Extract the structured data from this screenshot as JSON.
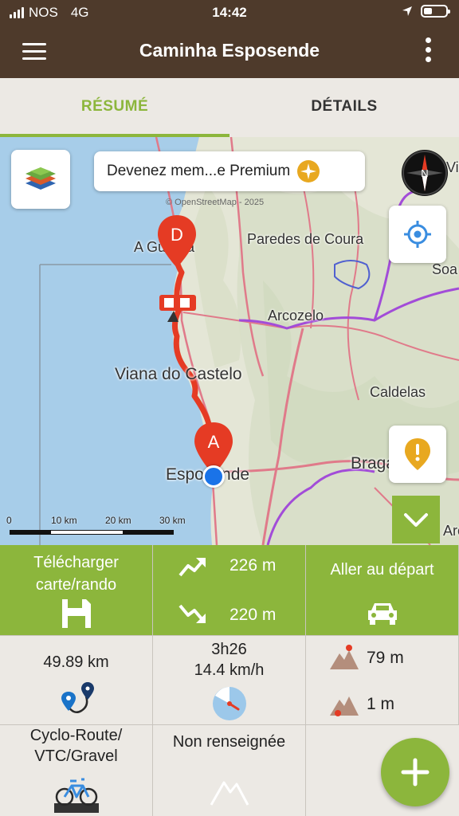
{
  "status_bar": {
    "carrier": "NOS",
    "network": "4G",
    "time": "14:42"
  },
  "app_bar": {
    "title": "Caminha Esposende"
  },
  "tabs": [
    {
      "label": "RÉSUMÉ",
      "active": true
    },
    {
      "label": "DÉTAILS",
      "active": false
    }
  ],
  "map": {
    "premium_banner": "Devenez mem...e Premium",
    "credit": "© OpenStreetMap - 2025",
    "marker_start": "A",
    "marker_end": "D",
    "places": [
      "A Guarda",
      "Paredes de Coura",
      "Arcozelo",
      "Viana do Castelo",
      "Caldelas",
      "Braga",
      "Esposende",
      "Soa",
      "Vilas",
      "Arca"
    ],
    "scale": [
      "0",
      "10 km",
      "20 km",
      "30 km"
    ]
  },
  "stats": {
    "download_label": "Télécharger carte/rando",
    "ascent": "226 m",
    "descent": "220 m",
    "go_to_start": "Aller au départ",
    "distance": "49.89 km",
    "duration": "3h26",
    "speed": "14.4 km/h",
    "max_altitude": "79 m",
    "min_altitude": "1 m",
    "activity": "Cyclo-Route/ VTC/Gravel",
    "difficulty": "Non renseignée"
  },
  "colors": {
    "brand_brown": "#4e3a2b",
    "accent_green": "#8cb63c",
    "route_red": "#e53b24",
    "marker_red": "#e53b24",
    "location_blue": "#1a73e8"
  },
  "icons": [
    "layers-icon",
    "premium-star-icon",
    "compass-icon",
    "locate-icon",
    "warning-icon",
    "chevron-down-icon",
    "floppy-disk-icon",
    "ascent-icon",
    "descent-icon",
    "car-icon",
    "route-pins-icon",
    "stopwatch-icon",
    "mountain-high-icon",
    "mountain-low-icon",
    "bicycle-icon",
    "mountain-outline-icon",
    "plus-icon"
  ]
}
